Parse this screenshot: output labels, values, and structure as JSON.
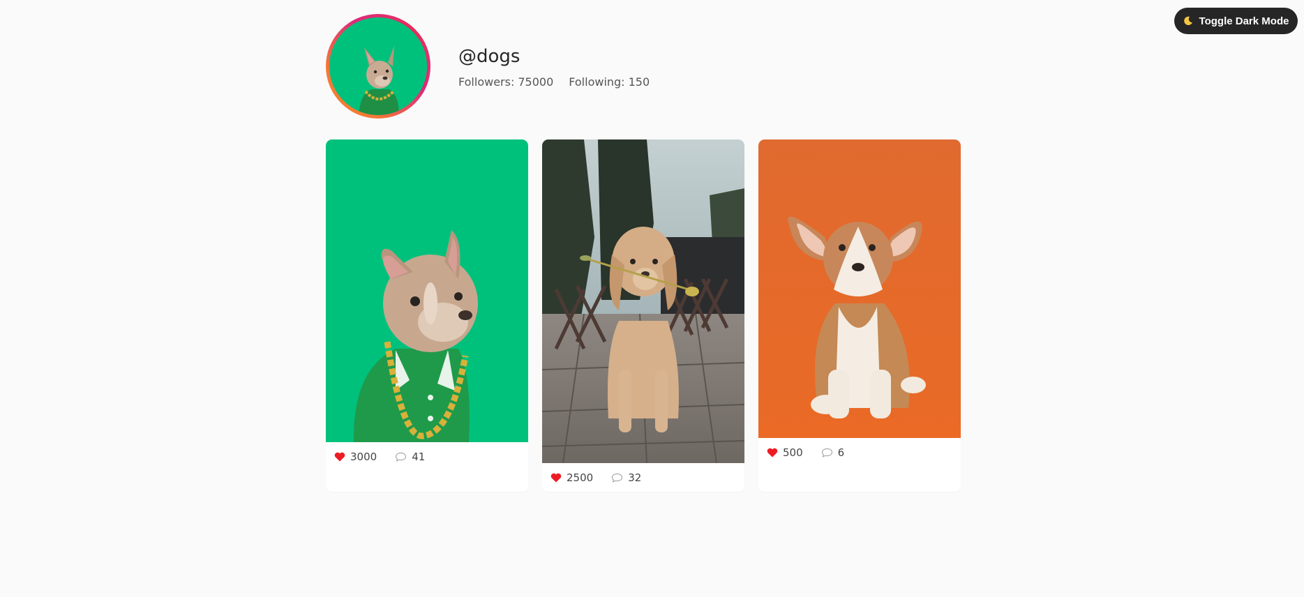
{
  "header": {
    "toggle_label": "Toggle Dark Mode",
    "toggle_icon": "moon-icon"
  },
  "profile": {
    "username": "@dogs",
    "followers_label": "Followers:",
    "followers": "75000",
    "following_label": "Following:",
    "following": "150"
  },
  "posts": [
    {
      "likes": "3000",
      "comments": "41",
      "bg_color": "#00c17c",
      "subject": "french bulldog in green jacket with gold chain"
    },
    {
      "likes": "2500",
      "comments": "32",
      "bg_color": "#8a8580",
      "subject": "golden retriever holding a flower"
    },
    {
      "likes": "500",
      "comments": "6",
      "bg_color": "#e76a2e",
      "subject": "corgi puppy sitting"
    }
  ],
  "colors": {
    "background": "#fafafa",
    "heart": "#ed1c24",
    "button_bg": "#262626"
  }
}
